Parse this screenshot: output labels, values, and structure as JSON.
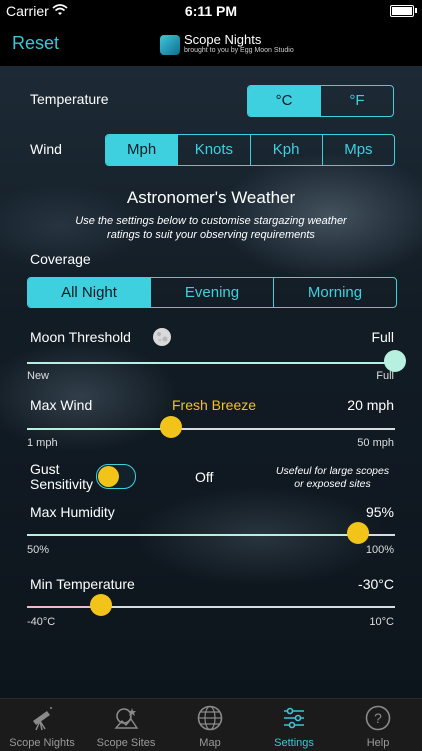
{
  "status_bar": {
    "carrier": "Carrier",
    "time": "6:11 PM"
  },
  "nav": {
    "reset_label": "Reset",
    "app_title": "Scope Nights",
    "app_subtitle": "brought to you by Egg Moon Studio"
  },
  "temperature": {
    "label": "Temperature",
    "options": [
      "°C",
      "°F"
    ],
    "selected": "°C"
  },
  "wind": {
    "label": "Wind",
    "options": [
      "Mph",
      "Knots",
      "Kph",
      "Mps"
    ],
    "selected": "Mph"
  },
  "astro": {
    "heading": "Astronomer's Weather",
    "description": "Use the settings below to customise stargazing weather ratings to suit your observing requirements"
  },
  "coverage": {
    "label": "Coverage",
    "options": [
      "All Night",
      "Evening",
      "Morning"
    ],
    "selected": "All Night"
  },
  "moon": {
    "label": "Moon Threshold",
    "value": "Full",
    "min_label": "New",
    "max_label": "Full",
    "level": 1.0
  },
  "max_wind": {
    "label": "Max Wind",
    "description": "Fresh Breeze",
    "value": "20 mph",
    "min_label": "1 mph",
    "max_label": "50 mph",
    "level": 0.39
  },
  "gust": {
    "label": "Gust Sensitivity",
    "state": "Off",
    "note": "Usefeul for large scopes or exposed sites"
  },
  "humidity": {
    "label": "Max Humidity",
    "value": "95%",
    "min_label": "50%",
    "max_label": "100%",
    "level": 0.9
  },
  "min_temp": {
    "label": "Min Temperature",
    "value": "-30°C",
    "min_label": "-40°C",
    "max_label": "10°C",
    "level": 0.2
  },
  "tabs": [
    {
      "label": "Scope Nights",
      "icon": "telescope-icon"
    },
    {
      "label": "Scope Sites",
      "icon": "sites-icon"
    },
    {
      "label": "Map",
      "icon": "globe-icon"
    },
    {
      "label": "Settings",
      "icon": "sliders-icon",
      "active": true
    },
    {
      "label": "Help",
      "icon": "help-icon"
    }
  ],
  "colors": {
    "accent": "#3fd0e0",
    "yellow": "#f2c419",
    "mint": "#b8f0e0",
    "tab_active": "#3fc6d6"
  }
}
